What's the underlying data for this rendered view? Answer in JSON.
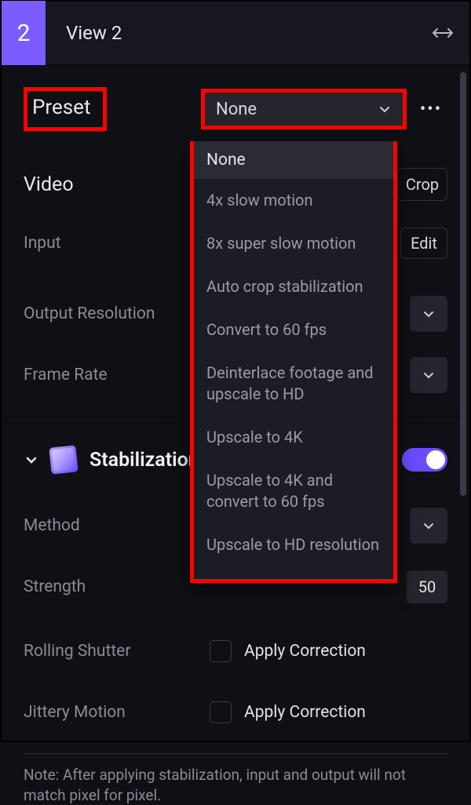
{
  "header": {
    "badge": "2",
    "title": "View 2"
  },
  "preset": {
    "label": "Preset",
    "selected": "None",
    "options": [
      "None",
      "4x slow motion",
      "8x super slow motion",
      "Auto crop stabilization",
      "Convert to 60 fps",
      "Deinterlace footage and upscale to HD",
      "Upscale to 4K",
      "Upscale to 4K and convert to 60 fps",
      "Upscale to HD resolution"
    ]
  },
  "video": {
    "title": "Video",
    "crop": "Crop",
    "input_label": "Input",
    "edit": "Edit",
    "output_res_label": "Output Resolution",
    "frame_rate_label": "Frame Rate"
  },
  "stabilization": {
    "title": "Stabilization",
    "method_label": "Method",
    "strength_label": "Strength",
    "strength_value": "50",
    "rolling_shutter_label": "Rolling Shutter",
    "jittery_label": "Jittery Motion",
    "apply_correction": "Apply Correction",
    "note": "Note: After applying stabilization, input and output will not match pixel for pixel."
  }
}
